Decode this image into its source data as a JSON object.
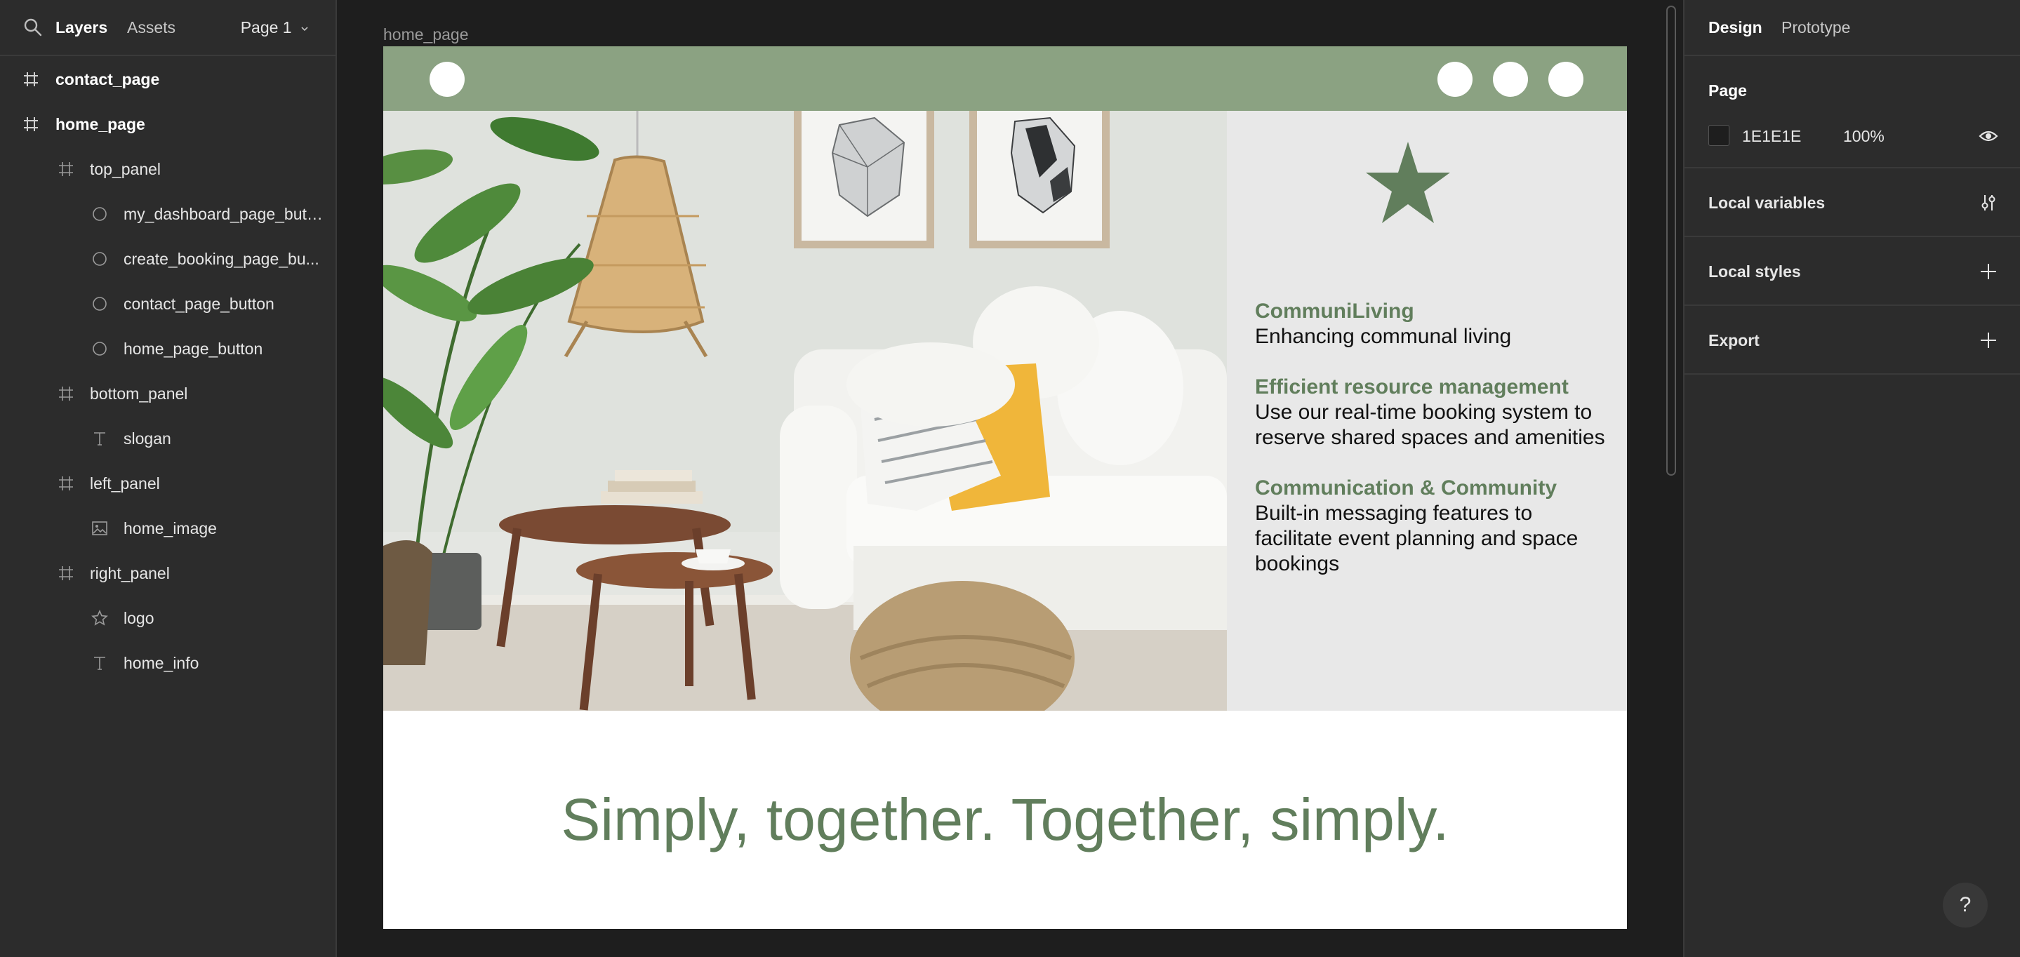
{
  "sidebar": {
    "tabs": {
      "layers": "Layers",
      "assets": "Assets"
    },
    "page_selector": "Page 1",
    "layers": [
      {
        "label": "contact_page",
        "icon": "frame-icon"
      },
      {
        "label": "home_page",
        "icon": "frame-icon"
      },
      {
        "label": "top_panel",
        "icon": "frame-icon"
      },
      {
        "label": "my_dashboard_page_butt...",
        "icon": "ellipse-icon"
      },
      {
        "label": "create_booking_page_bu...",
        "icon": "ellipse-icon"
      },
      {
        "label": "contact_page_button",
        "icon": "ellipse-icon"
      },
      {
        "label": "home_page_button",
        "icon": "ellipse-icon"
      },
      {
        "label": "bottom_panel",
        "icon": "frame-icon"
      },
      {
        "label": "slogan",
        "icon": "text-icon"
      },
      {
        "label": "left_panel",
        "icon": "frame-icon"
      },
      {
        "label": "home_image",
        "icon": "image-icon"
      },
      {
        "label": "right_panel",
        "icon": "frame-icon"
      },
      {
        "label": "logo",
        "icon": "star-icon"
      },
      {
        "label": "home_info",
        "icon": "text-icon"
      }
    ]
  },
  "canvas": {
    "frame_label": "home_page",
    "home_info": {
      "title": "CommuniLiving",
      "subtitle": "Enhancing communal living",
      "feature1_title": "Efficient resource management",
      "feature1_body": "Use our real-time booking system to reserve shared spaces and amenities",
      "feature2_title": "Communication & Community",
      "feature2_body": "Built-in messaging features to facilitate event planning and space bookings"
    },
    "slogan": "Simply, together. Together, simply.",
    "colors": {
      "top_panel": "#8ba282",
      "accent": "#617e5c",
      "right_panel": "#e8e8e8"
    }
  },
  "properties": {
    "tabs": {
      "design": "Design",
      "prototype": "Prototype"
    },
    "page_section": {
      "title": "Page",
      "color": "1E1E1E",
      "opacity": "100%"
    },
    "local_variables": "Local variables",
    "local_styles": "Local styles",
    "export": "Export"
  },
  "help": "?"
}
